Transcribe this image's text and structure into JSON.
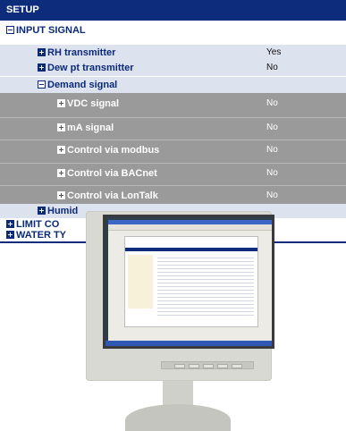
{
  "setup": {
    "title": "SETUP",
    "input_signal": "INPUT SIGNAL",
    "rh_transmitter": {
      "label": "RH transmitter",
      "value": "Yes"
    },
    "dew_pt_transmitter": {
      "label": "Dew pt transmitter",
      "value": "No"
    },
    "demand_signal": "Demand signal",
    "vdc_signal": {
      "label": "VDC signal",
      "value": "No"
    },
    "ma_signal": {
      "label": "mA signal",
      "value": "No"
    },
    "control_modbus": {
      "label": "Control via modbus",
      "value": "No"
    },
    "control_bacnet": {
      "label": "Control via BACnet",
      "value": "No"
    },
    "control_lontalk": {
      "label": "Control via LonTalk",
      "value": "No"
    },
    "humid_partial": "Humid",
    "limit_partial": "LIMIT CO",
    "water_partial": "WATER TY"
  },
  "colors": {
    "header": "#0d2d7c",
    "level1_bg": "#dde2ef",
    "level2_bg": "#9a9a9a"
  },
  "icons": {
    "expand": "plus-box-icon",
    "collapse": "minus-box-icon"
  }
}
